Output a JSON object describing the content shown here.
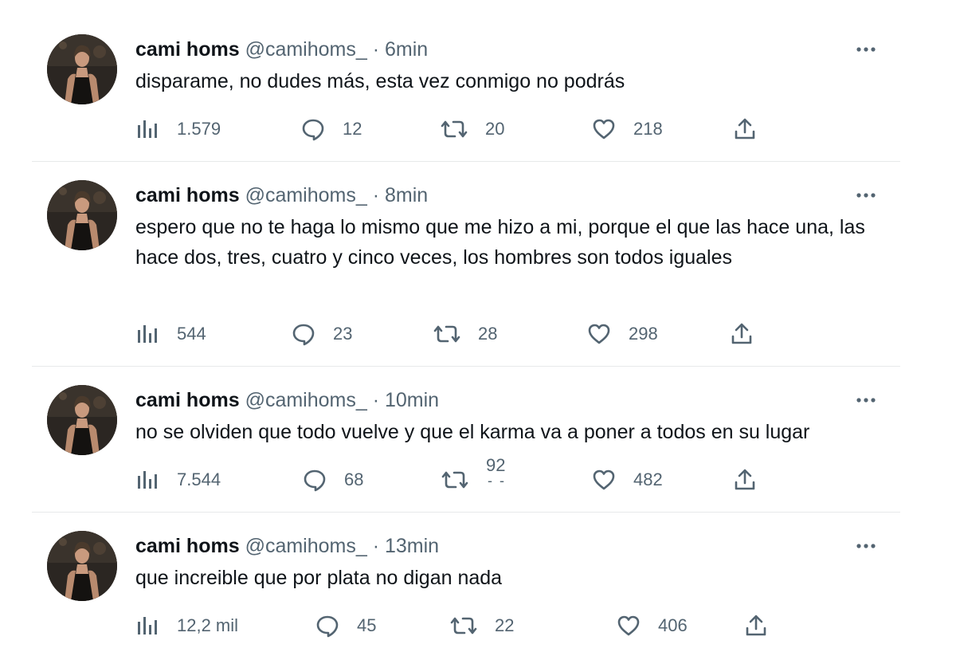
{
  "colors": {
    "text_primary": "#0f1419",
    "text_secondary": "#536471",
    "divider": "#e7e9ea"
  },
  "tweets": [
    {
      "name": "cami homs",
      "handle": "@camihoms_",
      "separator": "·",
      "time": "6min",
      "text": "disparame, no dudes más, esta vez conmigo no podrás",
      "views": "1.579",
      "replies": "12",
      "retweets": "20",
      "likes": "218"
    },
    {
      "name": "cami homs",
      "handle": "@camihoms_",
      "separator": "·",
      "time": "8min",
      "text": "espero que no te haga lo mismo que me hizo a mi, porque el que las hace una, las hace dos, tres, cuatro y cinco veces, los hombres son todos iguales",
      "views": "544",
      "replies": "23",
      "retweets": "28",
      "likes": "298"
    },
    {
      "name": "cami homs",
      "handle": "@camihoms_",
      "separator": "·",
      "time": "10min",
      "text": "no se olviden que todo vuelve y que el karma va a poner a todos en su lugar",
      "views": "7.544",
      "replies": "68",
      "retweets": "92",
      "likes": "482"
    },
    {
      "name": "cami homs",
      "handle": "@camihoms_",
      "separator": "·",
      "time": "13min",
      "text": "que increible que por plata no digan nada",
      "views": "12,2 mil",
      "replies": "45",
      "retweets": "22",
      "likes": "406"
    }
  ],
  "icons": {
    "views": "views-chart-icon",
    "reply": "reply-bubble-icon",
    "retweet": "retweet-icon",
    "like": "heart-icon",
    "share": "share-upload-icon",
    "more": "more-dots-icon"
  }
}
